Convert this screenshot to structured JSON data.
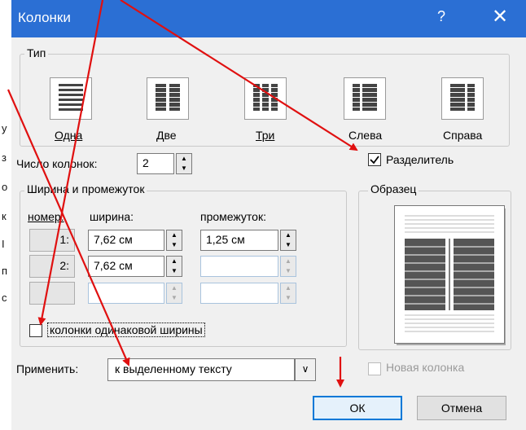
{
  "window": {
    "title": "Колонки",
    "help_glyph": "?",
    "close_glyph": "✕"
  },
  "background": {
    "fragments": [
      "у",
      "з",
      "о",
      "к",
      "I",
      "п",
      "с"
    ]
  },
  "type_group": {
    "legend": "Тип",
    "presets": [
      {
        "label": "Одна",
        "icon": "one-column-icon"
      },
      {
        "label": "Две",
        "icon": "two-columns-icon"
      },
      {
        "label": "Три",
        "icon": "three-columns-icon"
      },
      {
        "label": "Слева",
        "icon": "left-column-icon"
      },
      {
        "label": "Справа",
        "icon": "right-column-icon"
      }
    ]
  },
  "columns_count": {
    "label": "Число колонок:",
    "value": "2"
  },
  "separator": {
    "label": "Разделитель",
    "checked": true
  },
  "width_group": {
    "legend": "Ширина и промежуток",
    "col_number": "номер:",
    "col_width": "ширина:",
    "col_spacing": "промежуток:",
    "rows": [
      {
        "num": "1:",
        "width": "7,62 см",
        "spacing": "1,25 см"
      },
      {
        "num": "2:",
        "width": "7,62 см",
        "spacing": ""
      },
      {
        "num": "",
        "width": "",
        "spacing": ""
      }
    ]
  },
  "equal_width": {
    "label": "колонки одинаковой ширины",
    "checked": false
  },
  "sample": {
    "legend": "Образец"
  },
  "apply": {
    "label": "Применить:",
    "value": "к выделенному тексту"
  },
  "new_column": {
    "label": "Новая колонка",
    "checked": false
  },
  "buttons": {
    "ok": "ОК",
    "cancel": "Отмена"
  },
  "colors": {
    "titlebar": "#2b6fd4",
    "annotation_arrow": "#e01010"
  }
}
